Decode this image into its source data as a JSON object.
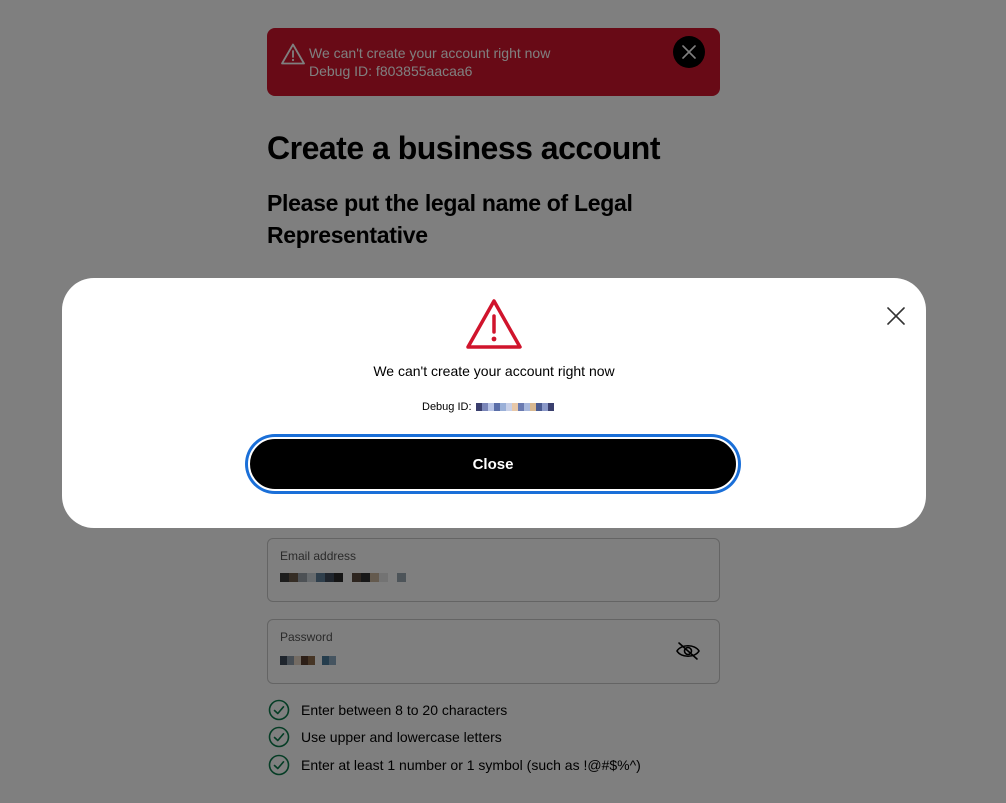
{
  "banner": {
    "message": "We can't create your account right now",
    "debug_line": "Debug ID: f803855aacaa6",
    "icon": "warning-triangle-icon",
    "close_icon": "close-icon"
  },
  "page": {
    "title": "Create a business account",
    "subtitle": "Please put the legal name of Legal Representative"
  },
  "form": {
    "email": {
      "label": "Email address"
    },
    "password": {
      "label": "Password",
      "visibility_icon": "eye-off-icon"
    },
    "rules": [
      {
        "text": "Enter between 8 to 20 characters",
        "status": "met"
      },
      {
        "text": "Use upper and lowercase letters",
        "status": "met"
      },
      {
        "text": "Enter at least 1 number or 1 symbol (such as !@#$%^)",
        "status": "met"
      }
    ]
  },
  "modal": {
    "message": "We can't create your account right now",
    "debug_label": "Debug ID:",
    "close_button": "Close",
    "icon": "warning-triangle-icon"
  },
  "colors": {
    "error": "#d0142c",
    "success": "#0a7a4a",
    "focus_ring": "#1a6fd8",
    "overlay": "rgba(0,0,0,0.5)"
  }
}
